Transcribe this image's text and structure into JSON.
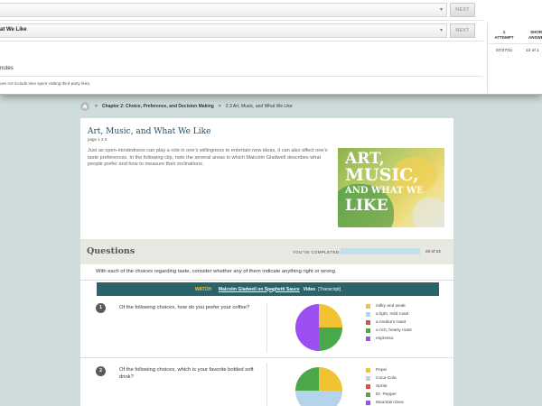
{
  "overlay": {
    "select1_text": "",
    "select2_text": "at We Like",
    "next_label": "NEXT",
    "minutes_text": "nutes",
    "note_text": "oes not include time spent visiting third-party links.",
    "attempts": {
      "col1_header": "1\nATTEMPT",
      "col2_header": "SHORT\nANSWER",
      "date": "07/27/11",
      "score": "13 of 1"
    }
  },
  "breadcrumb": {
    "chapter": "Chapter 2: Choice, Preference, and Decision Making",
    "current": "2.3 Art, Music, and What We Like",
    "separator": ">"
  },
  "section": {
    "title": "Art, Music, and What We Like",
    "page_ref": "page 1 2 3",
    "intro": "Just as open-mindedness can play a role in one’s willingness to entertain new ideas, it can also affect one’s taste preferences. In the following clip, note the several areas in which Malcolm Gladwell describes what people prefer and how to measure their inclinations.",
    "hero_lines": [
      "ART,",
      "MUSIC,",
      "AND WHAT WE",
      "LIKE"
    ]
  },
  "questions_band": {
    "title": "Questions",
    "completed_label": "YOU’VE COMPLETED:",
    "progress_fraction": 1.0,
    "progress_count": "23 of 23"
  },
  "instructions": "With each of the choices regarding taste, consider whether any of them indicate anything right or wrong.",
  "watch": {
    "label": "WATCH",
    "link": "Malcolm Gladwell on Spaghetti Sauce",
    "type": "Video",
    "transcript": "[Transcript]"
  },
  "questions": [
    {
      "number": "1",
      "text": "Of the following choices, how do you prefer your coffee?",
      "options": [
        {
          "label": "milky and weak",
          "color": "#f1c232",
          "share": 0.25
        },
        {
          "label": "a light, mild roast",
          "color": "#b4d4ec",
          "share": 0.0
        },
        {
          "label": "a medium roast",
          "color": "#e04b4b",
          "share": 0.0
        },
        {
          "label": "a rich, hearty roast",
          "color": "#4aa84a",
          "share": 0.25
        },
        {
          "label": "espresso",
          "color": "#9b4ff0",
          "share": 0.5
        }
      ]
    },
    {
      "number": "2",
      "text": "Of the following choices, which is your favorite bottled soft drink?",
      "options": [
        {
          "label": "Pepsi",
          "color": "#f1c232",
          "share": 0.25
        },
        {
          "label": "Coca-Cola",
          "color": "#b4d4ec",
          "share": 0.5
        },
        {
          "label": "Sprite",
          "color": "#e04b4b",
          "share": 0.0
        },
        {
          "label": "Dr. Pepper",
          "color": "#4aa84a",
          "share": 0.25
        },
        {
          "label": "Mountain Dew",
          "color": "#9b4ff0",
          "share": 0.0
        }
      ]
    }
  ]
}
